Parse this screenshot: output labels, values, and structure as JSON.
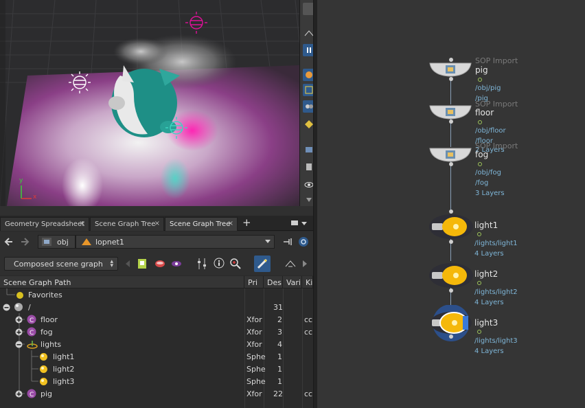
{
  "tabs": [
    {
      "label": "Geometry Spreadsheet"
    },
    {
      "label": "Scene Graph Tree"
    },
    {
      "label": "Scene Graph Tree"
    }
  ],
  "tab_add": "+",
  "tab_close": "×",
  "path": {
    "root": "obj",
    "network": "lopnet1"
  },
  "options": {
    "view_mode": "Composed scene graph"
  },
  "tree": {
    "headers": [
      "Scene Graph Path",
      "Pri",
      "Des",
      "Vari",
      "Ki"
    ],
    "rows": [
      {
        "name": "Favorites",
        "pri": "",
        "des": "",
        "kind": ""
      },
      {
        "name": "/",
        "pri": "",
        "des": "31",
        "kind": ""
      },
      {
        "name": "floor",
        "pri": "Xfor",
        "des": "2",
        "kind": "cc"
      },
      {
        "name": "fog",
        "pri": "Xfor",
        "des": "3",
        "kind": "cc"
      },
      {
        "name": "lights",
        "pri": "Xfor",
        "des": "4",
        "kind": ""
      },
      {
        "name": "light1",
        "pri": "Sphe",
        "des": "1",
        "kind": ""
      },
      {
        "name": "light2",
        "pri": "Sphe",
        "des": "1",
        "kind": ""
      },
      {
        "name": "light3",
        "pri": "Sphe",
        "des": "1",
        "kind": ""
      },
      {
        "name": "pig",
        "pri": "Xfor",
        "des": "22",
        "kind": "cc"
      }
    ]
  },
  "viewport": {
    "axis_y": "y",
    "axis_x": "x"
  },
  "network": {
    "nodes": [
      {
        "type": "SOP Import",
        "name": "pig",
        "path": "/obj/pig",
        "prim": "/pig",
        "layers": ""
      },
      {
        "type": "SOP Import",
        "name": "floor",
        "path": "/obj/floor",
        "prim": "/floor",
        "layers": "2 Layers"
      },
      {
        "type": "SOP Import",
        "name": "fog",
        "path": "/obj/fog",
        "prim": "/fog",
        "layers": "3 Layers"
      },
      {
        "type": "",
        "name": "light1",
        "path": "/lights/light1",
        "prim": "",
        "layers": "4 Layers"
      },
      {
        "type": "",
        "name": "light2",
        "path": "/lights/light2",
        "prim": "",
        "layers": "4 Layers"
      },
      {
        "type": "",
        "name": "light3",
        "path": "/lights/light3",
        "prim": "",
        "layers": "4 Layers"
      }
    ]
  },
  "colors": {
    "accent_magenta": "#e0109a",
    "accent_teal": "#1f9a8f",
    "wire": "#8aa0b8",
    "path_text": "#7fb6d8",
    "bulb": "#f5b80a"
  }
}
